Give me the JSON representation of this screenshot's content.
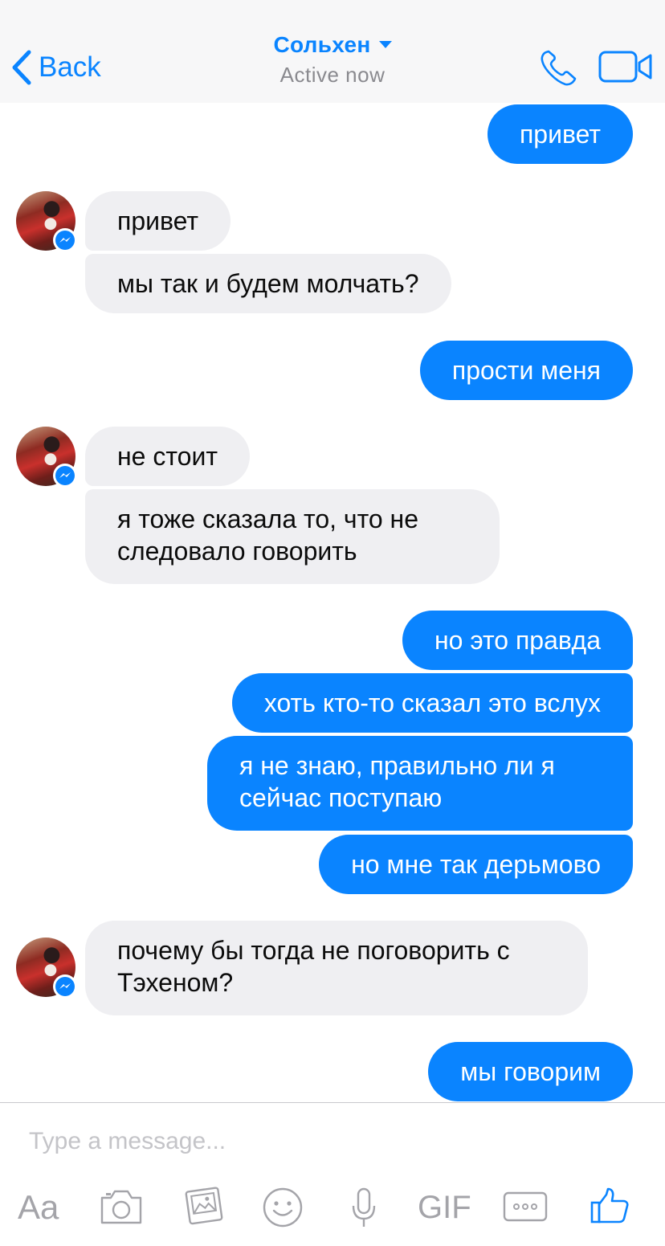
{
  "header": {
    "back_label": "Back",
    "title": "Сольхен",
    "subtitle": "Active now",
    "accent_color": "#0a84ff"
  },
  "messages": [
    {
      "id": "m1",
      "direction": "outgoing",
      "text": "привет"
    },
    {
      "id": "m2",
      "direction": "incoming",
      "text": "привет"
    },
    {
      "id": "m3",
      "direction": "incoming",
      "text": "мы так и будем молчать?"
    },
    {
      "id": "m4",
      "direction": "outgoing",
      "text": "прости меня"
    },
    {
      "id": "m5",
      "direction": "incoming",
      "text": "не стоит"
    },
    {
      "id": "m6",
      "direction": "incoming",
      "text": "я тоже сказала то, что не следовало говорить"
    },
    {
      "id": "m7",
      "direction": "outgoing",
      "text": "но это правда"
    },
    {
      "id": "m8",
      "direction": "outgoing",
      "text": "хоть кто-то сказал это вслух"
    },
    {
      "id": "m9",
      "direction": "outgoing",
      "text": "я не знаю, правильно ли я сейчас поступаю"
    },
    {
      "id": "m10",
      "direction": "outgoing",
      "text": "но мне так дерьмово"
    },
    {
      "id": "m11",
      "direction": "incoming",
      "text": "почему бы тогда не поговорить с Тэхеном?"
    },
    {
      "id": "m12",
      "direction": "outgoing",
      "text": "мы говорим"
    }
  ],
  "composer": {
    "placeholder": "Type a message...",
    "text_tool_label": "Aa",
    "gif_label": "GIF",
    "tools": [
      "text-icon",
      "camera-icon",
      "gallery-icon",
      "emoji-icon",
      "microphone-icon",
      "gif-icon",
      "more-icon",
      "like-icon"
    ]
  }
}
